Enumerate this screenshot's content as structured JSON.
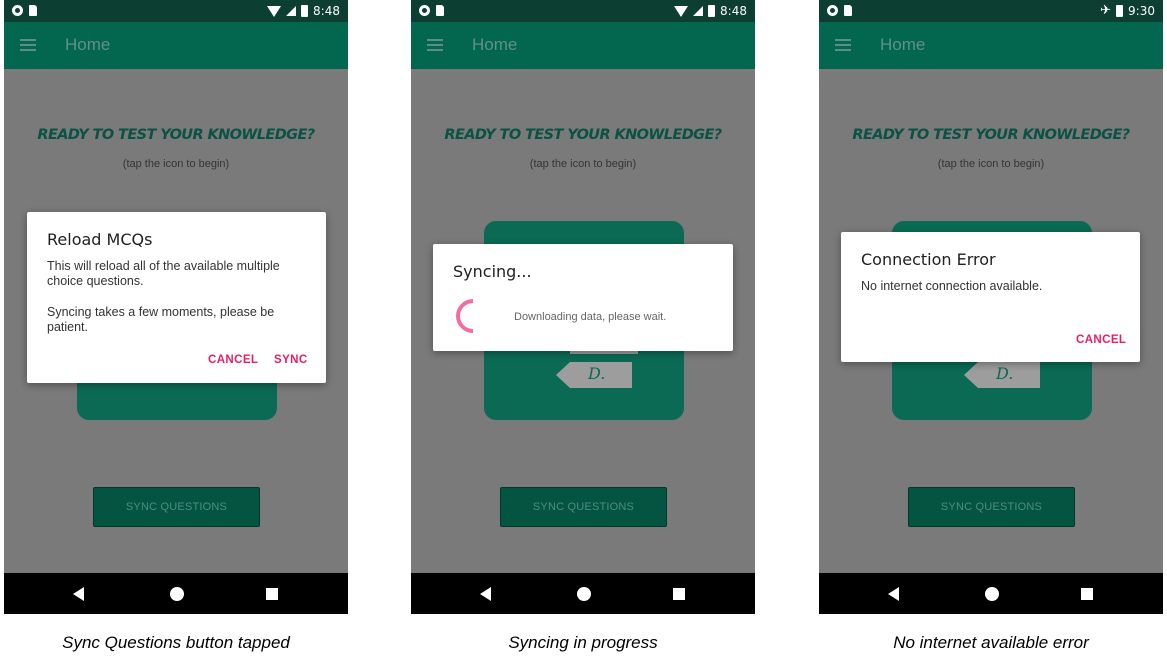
{
  "captions": [
    "Sync Questions button tapped",
    "Syncing in progress",
    "No internet available error"
  ],
  "screens": [
    {
      "status": {
        "time": "8:48"
      },
      "app_bar": {
        "title": "Home"
      },
      "main": {
        "hero_title": "READY TO TEST YOUR KNOWLEDGE?",
        "hero_subtitle": "(tap the icon to begin)",
        "sync_button": "SYNC QUESTIONS"
      },
      "dialog": {
        "title": "Reload MCQs",
        "message_1": "This will reload all of the available multiple choice questions.",
        "message_2": "Syncing takes a few moments, please be patient.",
        "cancel": "CANCEL",
        "confirm": "SYNC"
      }
    },
    {
      "status": {
        "time": "8:48"
      },
      "app_bar": {
        "title": "Home"
      },
      "main": {
        "hero_title": "READY TO TEST YOUR KNOWLEDGE?",
        "hero_subtitle": "(tap the icon to begin)",
        "option_label": "D.",
        "sync_button": "SYNC QUESTIONS"
      },
      "dialog": {
        "title": "Syncing...",
        "message": "Downloading data, please wait."
      }
    },
    {
      "status": {
        "time": "9:30"
      },
      "app_bar": {
        "title": "Home"
      },
      "main": {
        "hero_title": "READY TO TEST YOUR KNOWLEDGE?",
        "hero_subtitle": "(tap the icon to begin)",
        "option_label": "D.",
        "sync_button": "SYNC QUESTIONS"
      },
      "dialog": {
        "title": "Connection Error",
        "message": "No internet connection available.",
        "cancel": "CANCEL"
      }
    }
  ],
  "colors": {
    "status_bar": "#0c3f31",
    "app_bar": "#03664f",
    "dimmed_background": "#7a7a7a",
    "accent": "#e91e63",
    "spinner": "#f26ea2"
  },
  "icons": [
    "menu-icon",
    "wifi-icon",
    "signal-icon",
    "battery-icon",
    "airplane-icon",
    "back-icon",
    "home-icon",
    "recent-apps-icon"
  ]
}
